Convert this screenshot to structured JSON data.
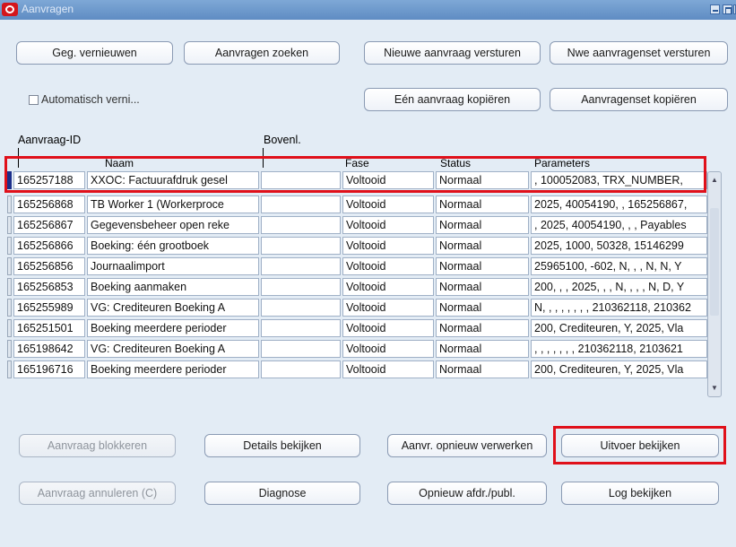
{
  "window": {
    "title": "Aanvragen"
  },
  "toolbar": {
    "refresh": "Geg. vernieuwen",
    "find": "Aanvragen zoeken",
    "submit_new": "Nieuwe aanvraag versturen",
    "submit_set": "Nwe aanvragenset versturen",
    "copy_single": "Eén aanvraag kopiëren",
    "copy_set": "Aanvragenset kopiëren"
  },
  "auto_refresh": {
    "label": "Automatisch verni...",
    "checked": false
  },
  "columns": {
    "id": "Aanvraag-ID",
    "parent": "Bovenl.",
    "name": "Naam",
    "phase": "Fase",
    "status": "Status",
    "params": "Parameters"
  },
  "rows": [
    {
      "id": "165257188",
      "name": "XXOC: Factuurafdruk gesel",
      "parent": "",
      "phase": "Voltooid",
      "status": "Normaal",
      "params": ", 100052083, TRX_NUMBER,"
    },
    {
      "id": "165256868",
      "name": "TB Worker 1 (Workerproce",
      "parent": "",
      "phase": "Voltooid",
      "status": "Normaal",
      "params": "2025, 40054190, , 165256867,"
    },
    {
      "id": "165256867",
      "name": "Gegevensbeheer open reke",
      "parent": "",
      "phase": "Voltooid",
      "status": "Normaal",
      "params": ", 2025, 40054190, , , Payables"
    },
    {
      "id": "165256866",
      "name": "Boeking: één grootboek",
      "parent": "",
      "phase": "Voltooid",
      "status": "Normaal",
      "params": "2025, 1000, 50328, 15146299"
    },
    {
      "id": "165256856",
      "name": "Journaalimport",
      "parent": "",
      "phase": "Voltooid",
      "status": "Normaal",
      "params": "25965100, -602, N, , , N, N, Y"
    },
    {
      "id": "165256853",
      "name": "Boeking aanmaken",
      "parent": "",
      "phase": "Voltooid",
      "status": "Normaal",
      "params": "200, , , 2025, , , N, , , , N, D, Y"
    },
    {
      "id": "165255989",
      "name": "VG: Crediteuren Boeking A",
      "parent": "",
      "phase": "Voltooid",
      "status": "Normaal",
      "params": "N, , , , , , , , 210362118, 210362"
    },
    {
      "id": "165251501",
      "name": "Boeking meerdere perioder",
      "parent": "",
      "phase": "Voltooid",
      "status": "Normaal",
      "params": "200, Crediteuren, Y, 2025, Vla"
    },
    {
      "id": "165198642",
      "name": "VG: Crediteuren Boeking A",
      "parent": "",
      "phase": "Voltooid",
      "status": "Normaal",
      "params": ", , , , , , , 210362118, 2103621"
    },
    {
      "id": "165196716",
      "name": "Boeking meerdere perioder",
      "parent": "",
      "phase": "Voltooid",
      "status": "Normaal",
      "params": "200, Crediteuren, Y, 2025, Vla"
    }
  ],
  "actions": {
    "hold": "Aanvraag blokkeren",
    "details": "Details bekijken",
    "resubmit": "Aanvr. opnieuw verwerken",
    "view_output": "Uitvoer bekijken",
    "cancel": "Aanvraag annuleren (C)",
    "diagnose": "Diagnose",
    "republish": "Opnieuw afdr./publ.",
    "view_log": "Log bekijken"
  },
  "colors": {
    "highlight": "#e0101a",
    "selected_indicator": "#1c2f8a",
    "title_bar": "#6a96cc"
  }
}
